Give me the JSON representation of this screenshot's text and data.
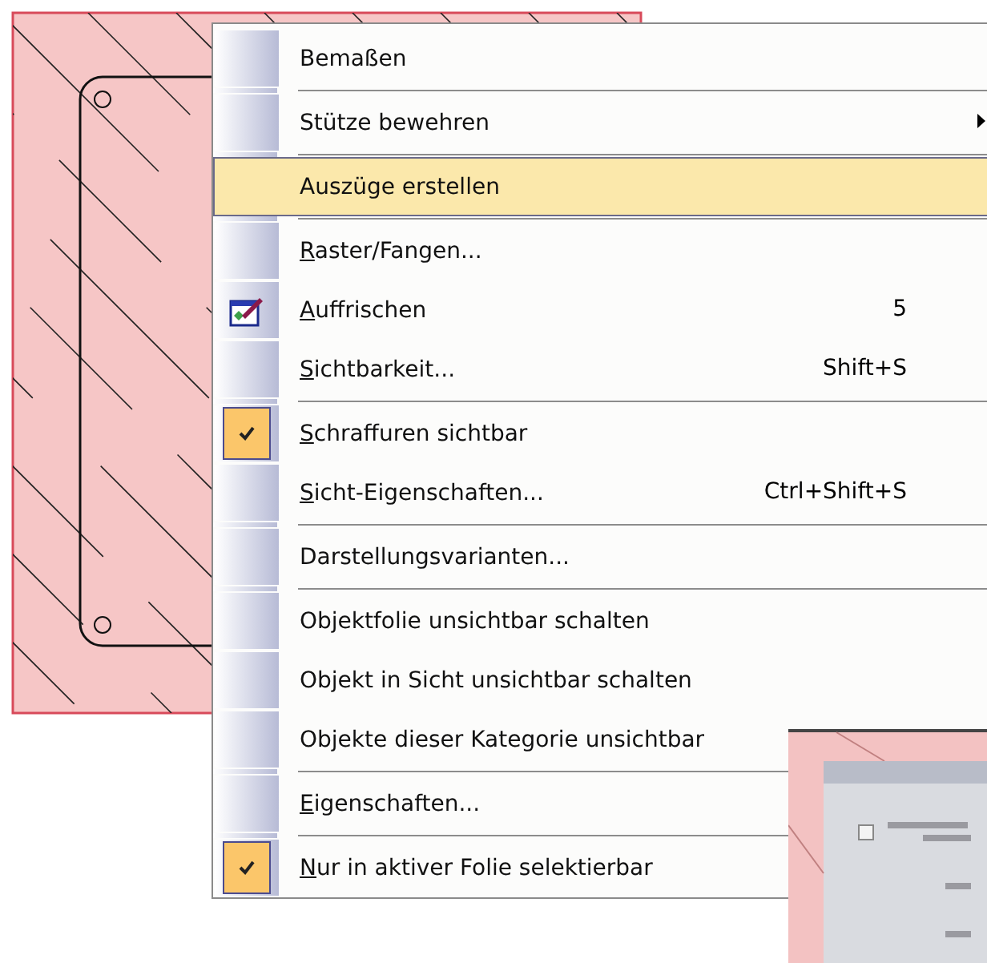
{
  "menu": {
    "items": [
      {
        "kind": "command",
        "label": "Bemaßen",
        "mnemonic": false,
        "selected": false
      },
      {
        "kind": "separator"
      },
      {
        "kind": "submenu",
        "label": "Stütze bewehren",
        "mnemonic": false,
        "selected": false
      },
      {
        "kind": "separator"
      },
      {
        "kind": "command",
        "label": "Auszüge erstellen",
        "mnemonic": false,
        "selected": true
      },
      {
        "kind": "separator"
      },
      {
        "kind": "command",
        "label": "Raster/Fangen...",
        "mnemonic": true,
        "selected": false
      },
      {
        "kind": "icon",
        "label": "Auffrischen",
        "shortcut": "5",
        "mnemonic": true,
        "selected": false
      },
      {
        "kind": "command",
        "label": "Sichtbarkeit...",
        "shortcut": "Shift+S",
        "mnemonic": true,
        "selected": false
      },
      {
        "kind": "separator"
      },
      {
        "kind": "check",
        "label": "Schraffuren sichtbar",
        "mnemonic": true,
        "checked": true,
        "selected": false
      },
      {
        "kind": "command",
        "label": "Sicht-Eigenschaften...",
        "shortcut": "Ctrl+Shift+S",
        "mnemonic": true,
        "selected": false
      },
      {
        "kind": "separator"
      },
      {
        "kind": "command",
        "label": "Darstellungsvarianten...",
        "mnemonic": false,
        "selected": false
      },
      {
        "kind": "separator"
      },
      {
        "kind": "command",
        "label": "Objektfolie unsichtbar schalten",
        "mnemonic": false,
        "selected": false
      },
      {
        "kind": "command",
        "label": "Objekt in Sicht unsichtbar schalten",
        "mnemonic": false,
        "selected": false
      },
      {
        "kind": "command",
        "label": "Objekte dieser Kategorie unsichtbar",
        "mnemonic": false,
        "selected": false
      },
      {
        "kind": "separator"
      },
      {
        "kind": "command",
        "label": "Eigenschaften...",
        "mnemonic": true,
        "selected": false
      },
      {
        "kind": "separator"
      },
      {
        "kind": "check",
        "label": "Nur in aktiver Folie selektierbar",
        "mnemonic": true,
        "checked": true,
        "selected": false
      }
    ]
  }
}
